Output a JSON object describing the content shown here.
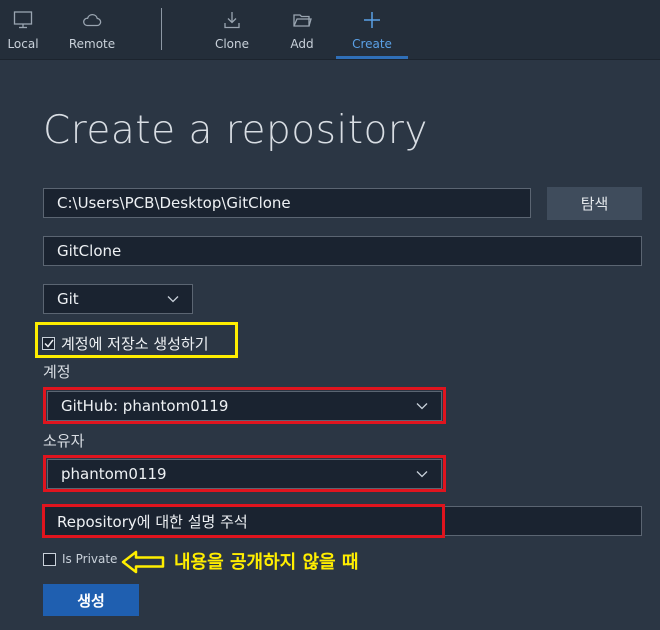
{
  "toolbar": {
    "local": "Local",
    "remote": "Remote",
    "clone": "Clone",
    "add": "Add",
    "create": "Create"
  },
  "page": {
    "title": "Create a repository"
  },
  "form": {
    "path_value": "C:\\Users\\PCB\\Desktop\\GitClone",
    "browse_label": "탐색",
    "name_value": "GitClone",
    "vcs_value": "Git",
    "create_on_account_label": "계정에 저장소 생성하기",
    "create_on_account_checked": true,
    "account_label": "계정",
    "account_value": "GitHub: phantom0119",
    "owner_label": "소유자",
    "owner_value": "phantom0119",
    "description_value": "Repository에 대한 설명 주석",
    "is_private_label": "Is Private",
    "is_private_checked": false,
    "create_button": "생성"
  },
  "annotation": {
    "text": "내용을 공개하지 않을 때"
  },
  "colors": {
    "background": "#2b3644",
    "accent": "#2f6fb8",
    "highlight_yellow": "#ffee00",
    "highlight_red": "#e0141e",
    "create_button": "#1f5fb0"
  },
  "icons": {
    "local": "monitor-icon",
    "remote": "cloud-icon",
    "clone": "download-icon",
    "add": "folder-icon",
    "create": "plus-icon"
  }
}
